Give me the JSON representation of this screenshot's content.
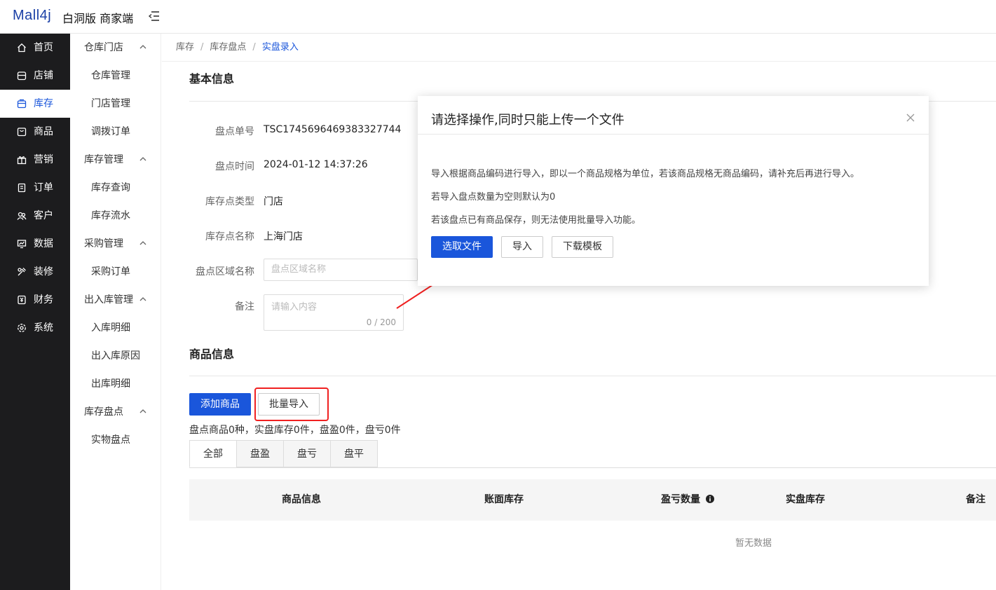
{
  "app": {
    "logo": "Mall4j",
    "edition": "白洞版 商家端"
  },
  "sidebar": {
    "items": [
      {
        "label": "首页",
        "icon": "home-icon"
      },
      {
        "label": "店铺",
        "icon": "shop-icon"
      },
      {
        "label": "库存",
        "icon": "stock-icon",
        "active": true
      },
      {
        "label": "商品",
        "icon": "goods-icon"
      },
      {
        "label": "营销",
        "icon": "gift-icon"
      },
      {
        "label": "订单",
        "icon": "order-icon"
      },
      {
        "label": "客户",
        "icon": "customer-icon"
      },
      {
        "label": "数据",
        "icon": "data-icon"
      },
      {
        "label": "装修",
        "icon": "decorate-icon"
      },
      {
        "label": "财务",
        "icon": "finance-icon"
      },
      {
        "label": "系统",
        "icon": "system-icon"
      }
    ]
  },
  "submenu": {
    "groups": [
      {
        "label": "仓库门店",
        "items": [
          "仓库管理",
          "门店管理",
          "调拨订单"
        ]
      },
      {
        "label": "库存管理",
        "items": [
          "库存查询",
          "库存流水"
        ]
      },
      {
        "label": "采购管理",
        "items": [
          "采购订单"
        ]
      },
      {
        "label": "出入库管理",
        "items": [
          "入库明细",
          "出入库原因",
          "出库明细"
        ]
      },
      {
        "label": "库存盘点",
        "items": [
          "实物盘点"
        ]
      }
    ]
  },
  "breadcrumb": {
    "items": [
      "库存",
      "库存盘点"
    ],
    "separator": "/",
    "current": "实盘录入"
  },
  "basic": {
    "title": "基本信息",
    "fields": {
      "order_no": {
        "label": "盘点单号",
        "value": "TSC1745696469383327744"
      },
      "time": {
        "label": "盘点时间",
        "value": "2024-01-12 14:37:26"
      },
      "point_type": {
        "label": "库存点类型",
        "value": "门店"
      },
      "point_name": {
        "label": "库存点名称",
        "value": "上海门店"
      },
      "area": {
        "label": "盘点区域名称",
        "placeholder": "盘点区域名称"
      },
      "remark": {
        "label": "备注",
        "placeholder": "请输入内容",
        "counter": "0 / 200"
      }
    }
  },
  "goods": {
    "title": "商品信息",
    "add_button": "添加商品",
    "import_button": "批量导入",
    "summary": "盘点商品0种，实盘库存0件，盘盈0件，盘亏0件",
    "tabs": [
      "全部",
      "盘盈",
      "盘亏",
      "盘平"
    ],
    "columns": [
      "商品信息",
      "账面库存",
      "盈亏数量",
      "实盘库存",
      "备注"
    ],
    "empty_text": "暂无数据"
  },
  "dialog": {
    "title": "请选择操作,同时只能上传一个文件",
    "lines": [
      "导入根据商品编码进行导入，即以一个商品规格为单位，若该商品规格无商品编码，请补充后再进行导入。",
      "若导入盘点数量为空则默认为0",
      "若该盘点已有商品保存，则无法使用批量导入功能。"
    ],
    "buttons": {
      "select_file": "选取文件",
      "import": "导入",
      "download_template": "下载模板"
    }
  },
  "colors": {
    "primary": "#1a56db",
    "sidebar_bg": "#1c1c1e",
    "annotation_red": "#f02020"
  }
}
